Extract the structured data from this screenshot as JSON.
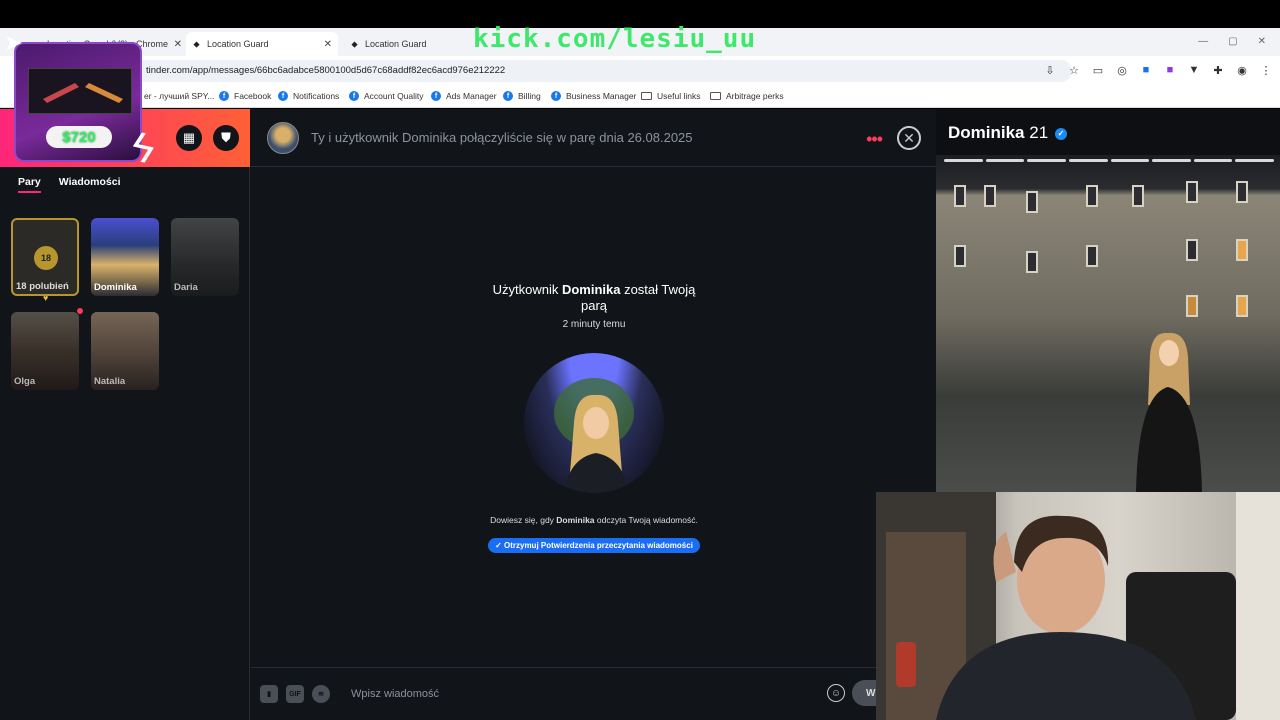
{
  "overlay": {
    "stream_title": "kick.com/lesiu_uu",
    "price_badge": "$720"
  },
  "browser": {
    "tabs": [
      {
        "title": "Location Guard (V3) - Chrome"
      },
      {
        "title": "Location Guard"
      },
      {
        "title": "Location Guard"
      }
    ],
    "url": "tinder.com/app/messages/66bc6adabce5800100d5d67c68addf82ec6acd976e212222",
    "bookmarks": [
      {
        "label": "er - лучший SPY..."
      },
      {
        "label": "Facebook"
      },
      {
        "label": "Notifications"
      },
      {
        "label": "Account Quality"
      },
      {
        "label": "Ads Manager"
      },
      {
        "label": "Billing"
      },
      {
        "label": "Business Manager"
      },
      {
        "label": "Useful links"
      },
      {
        "label": "Arbitrage perks"
      }
    ]
  },
  "sidebar": {
    "tabs": {
      "matches": "Pary",
      "messages": "Wiadomości"
    },
    "likes": {
      "count": "18",
      "label": "18 polubień"
    },
    "matches": [
      {
        "name": "Dominika"
      },
      {
        "name": "Daria"
      },
      {
        "name": "Olga"
      },
      {
        "name": "Natalia"
      }
    ]
  },
  "chat": {
    "header_text": "Ty i użytkownik Dominika połączyliście się w parę dnia 26.08.2025",
    "match_prefix": "Użytkownik ",
    "match_name": "Dominika",
    "match_suffix": " został Twoją parą",
    "match_time": "2 minuty temu",
    "read_note_prefix": "Dowiesz się, gdy ",
    "read_note_name": "Dominika",
    "read_note_suffix": " odczyta Twoją wiadomość.",
    "read_button": "✓ Otrzymuj Potwierdzenia przeczytania wiadomości",
    "composer": {
      "gif_label": "GIF",
      "placeholder": "Wpisz wiadomość",
      "send_label": "W"
    }
  },
  "profile": {
    "name": "Dominika",
    "age": "21"
  },
  "colors": {
    "brand_gradient_start": "#fd267a",
    "brand_gradient_end": "#ff6036",
    "accent_blue": "#1b6ef3",
    "overlay_green": "#3ee86b"
  }
}
